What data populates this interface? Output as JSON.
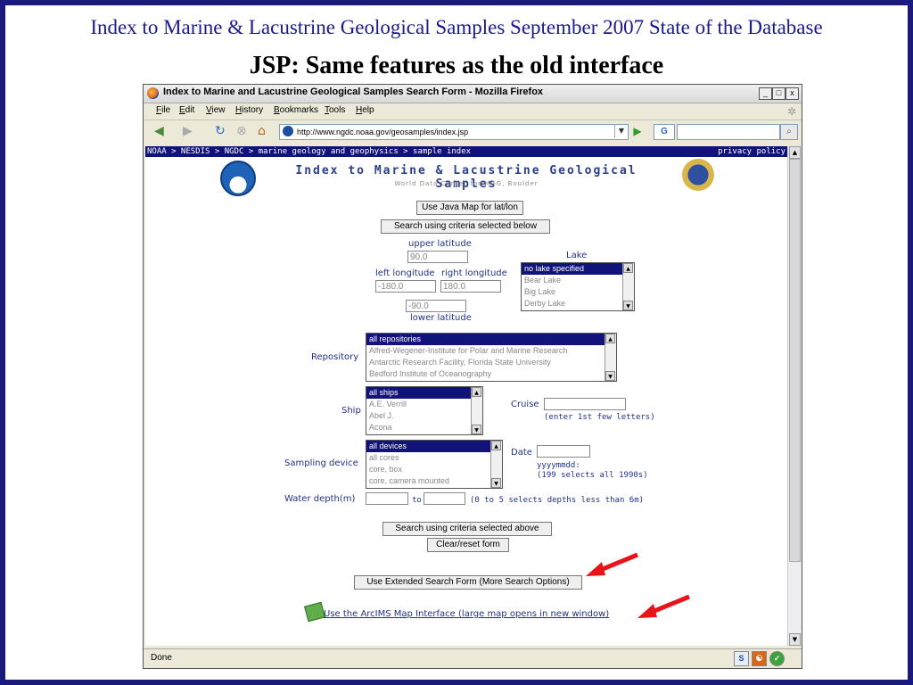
{
  "slide": {
    "title_line1": "Index to Marine & Lacustrine Geological Samples September 2007 State of the Database",
    "title_line2": "JSP: Same features as the old interface"
  },
  "window": {
    "title": "Index to Marine and Lacustrine Geological Samples Search Form - Mozilla Firefox",
    "controls": [
      "_",
      "□",
      "x"
    ]
  },
  "menu": [
    "File",
    "Edit",
    "View",
    "History",
    "Bookmarks",
    "Tools",
    "Help"
  ],
  "address": {
    "url": "http://www.ngdc.noaa.gov/geosamples/index.jsp"
  },
  "search_engine_icon": "G",
  "page": {
    "breadcrumb": "NOAA > NESDIS > NGDC > marine geology and geophysics > sample index",
    "privacy": "privacy policy",
    "heading": "Index to Marine & Lacustrine Geological Samples",
    "subheading": "World Data Center for MGG, Boulder",
    "java_map_button": "Use Java Map for lat/lon",
    "search_below_button": "Search using criteria selected below",
    "upper_latitude_label": "upper latitude",
    "upper_latitude_value": "90.0",
    "left_longitude_label": "left longitude",
    "left_longitude_value": "-180.0",
    "right_longitude_label": "right longitude",
    "right_longitude_value": "180.0",
    "lower_latitude_value": "-90.0",
    "lower_latitude_label": "lower latitude",
    "lake_label": "Lake",
    "lake_options": [
      "no lake specified",
      "Bear Lake",
      "Big Lake",
      "Derby Lake"
    ],
    "repository_label": "Repository",
    "repository_options": [
      "all repositories",
      "Alfred-Wegener-Institute for Polar and Marine Research",
      "Antarctic Research Facility, Florida State University",
      "Bedford Institute of Oceanography"
    ],
    "ship_label": "Ship",
    "ship_options": [
      "all ships",
      "A.E. Verrill",
      "Abel J.",
      "Acona"
    ],
    "cruise_label": "Cruise",
    "cruise_hint": "(enter 1st few letters)",
    "device_label": "Sampling device",
    "device_options": [
      "all devices",
      "all cores",
      "core, box",
      "core, camera mounted"
    ],
    "date_label": "Date",
    "date_hint1": "yyyymmdd:",
    "date_hint2": "(199 selects all 1990s)",
    "water_depth_label": "Water depth(m)",
    "to_label": "to",
    "depth_hint": "(0 to 5 selects depths less than 6m)",
    "search_above_button": "Search using criteria selected above",
    "clear_button": "Clear/reset form",
    "extended_button": "Use Extended Search Form (More Search Options)",
    "arcims_link": "Use the ArcIMS Map Interface (large map opens in new window)"
  },
  "status": {
    "text": "Done",
    "icons": [
      "S",
      "☯",
      "✓"
    ]
  },
  "colors": {
    "slide_border": "#1a1a7a",
    "arrow": "#e8141a",
    "link": "#21318a",
    "selected": "#12137a"
  }
}
